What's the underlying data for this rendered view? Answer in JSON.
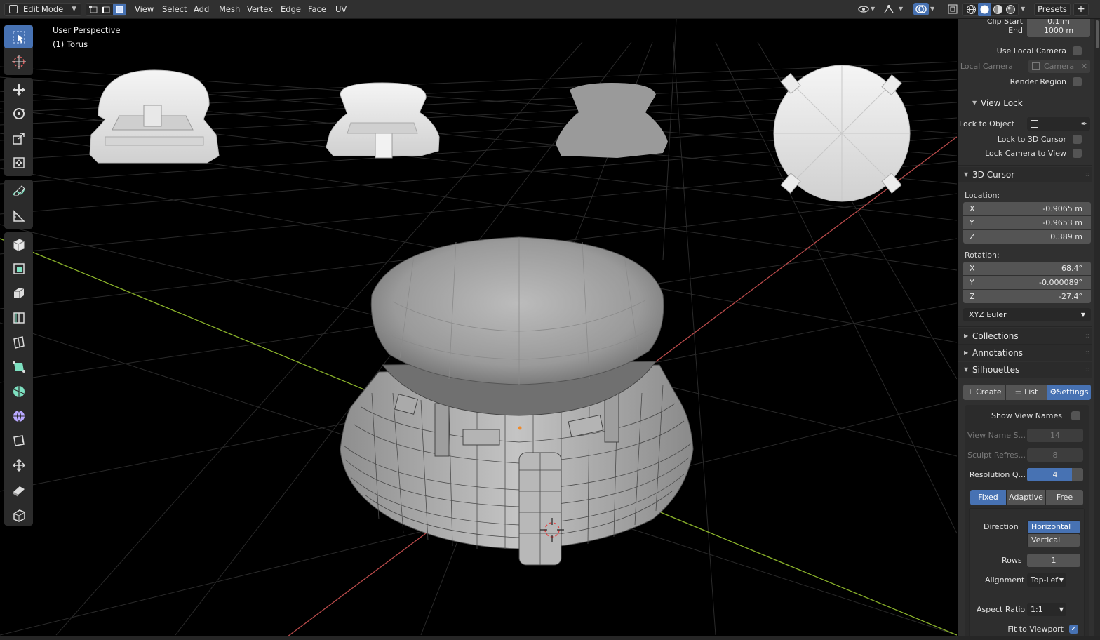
{
  "header": {
    "mode_label": "Edit Mode",
    "menus": [
      "View",
      "Select",
      "Add",
      "Mesh",
      "Vertex",
      "Edge",
      "Face",
      "UV"
    ],
    "presets_label": "Presets",
    "add_label": "+"
  },
  "viewport": {
    "perspective_label": "User Perspective",
    "object_label": "(1) Torus"
  },
  "toolbar": {
    "tools": [
      "select-box",
      "cursor",
      "move",
      "rotate",
      "scale",
      "transform",
      "annotate",
      "measure",
      "add-cube",
      "extrude",
      "inset",
      "bevel",
      "loop-cut",
      "knife",
      "poly-build",
      "spin",
      "smooth",
      "shrink-fatten",
      "push-pull",
      "shear",
      "rip"
    ]
  },
  "sidebar": {
    "clip_start_label": "Clip Start",
    "clip_start_value": "0.1 m",
    "end_label": "End",
    "end_value": "1000 m",
    "use_local_camera_label": "Use Local Camera",
    "local_camera_label": "Local Camera",
    "local_camera_value": "Camera",
    "render_region_label": "Render Region",
    "view_lock": {
      "title": "View Lock",
      "lock_to_object_label": "Lock to Object",
      "lock_to_3d_cursor_label": "Lock to 3D Cursor",
      "lock_camera_to_view_label": "Lock Camera to View"
    },
    "cursor": {
      "title": "3D Cursor",
      "location_label": "Location:",
      "location": [
        {
          "axis": "X",
          "value": "-0.9065 m"
        },
        {
          "axis": "Y",
          "value": "-0.9653 m"
        },
        {
          "axis": "Z",
          "value": "0.389 m"
        }
      ],
      "rotation_label": "Rotation:",
      "rotation": [
        {
          "axis": "X",
          "value": "68.4°"
        },
        {
          "axis": "Y",
          "value": "-0.000089°"
        },
        {
          "axis": "Z",
          "value": "-27.4°"
        }
      ],
      "rotation_mode": "XYZ Euler"
    },
    "collections_title": "Collections",
    "annotations_title": "Annotations",
    "silhouettes": {
      "title": "Silhouettes",
      "tabs": [
        "Create",
        "List",
        "Settings"
      ],
      "active_tab": "Settings",
      "show_view_names_label": "Show View Names",
      "view_name_size_label": "View Name S...",
      "view_name_size_value": "14",
      "sculpt_refresh_label": "Sculpt Refres...",
      "sculpt_refresh_value": "8",
      "resolution_label": "Resolution Q...",
      "resolution_value": "4",
      "resolution_fraction": 0.8,
      "layout_modes": [
        "Fixed",
        "Adaptive",
        "Free"
      ],
      "active_layout_mode": "Fixed",
      "direction_label": "Direction",
      "direction_options": [
        "Horizontal",
        "Vertical"
      ],
      "active_direction": "Horizontal",
      "rows_label": "Rows",
      "rows_value": "1",
      "alignment_label": "Alignment",
      "alignment_value": "Top-Lef",
      "aspect_ratio_label": "Aspect Ratio",
      "aspect_ratio_value": "1:1",
      "fit_to_viewport_label": "Fit to Viewport"
    }
  },
  "colors": {
    "accent": "#4772b3",
    "panel_bg": "#303030",
    "field_bg": "#545454",
    "x_axis": "#b84a4a",
    "y_axis": "#8ab22a"
  }
}
